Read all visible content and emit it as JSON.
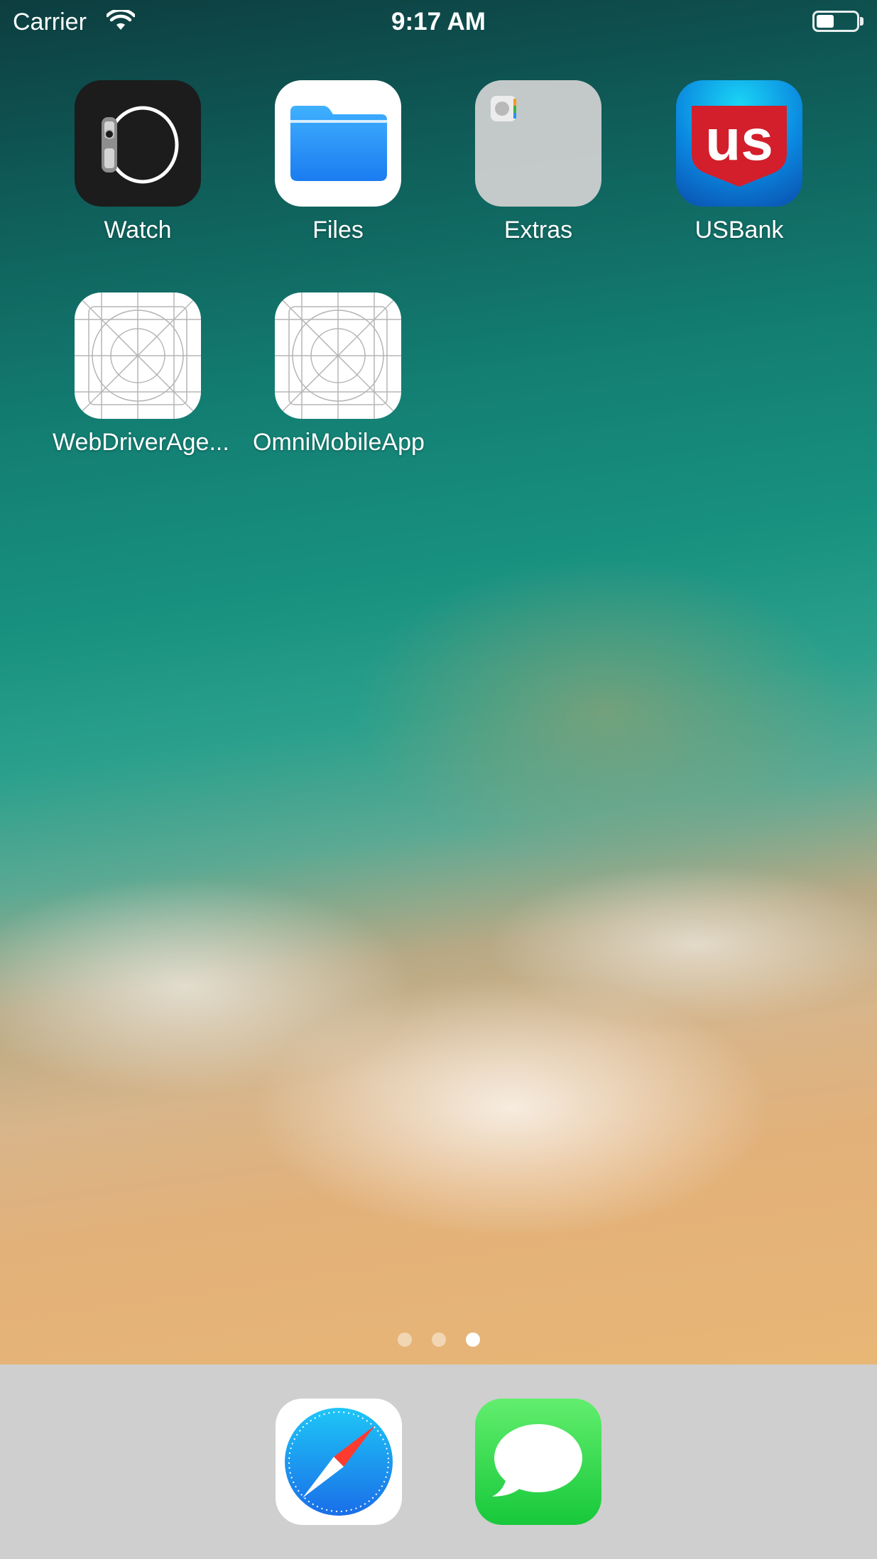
{
  "status_bar": {
    "carrier": "Carrier",
    "time": "9:17 AM",
    "battery_level": 0.45
  },
  "home_screen": {
    "apps": [
      {
        "label": "Watch"
      },
      {
        "label": "Files"
      },
      {
        "label": "Extras"
      },
      {
        "label": "USBank"
      },
      {
        "label": "WebDriverAge..."
      },
      {
        "label": "OmniMobileApp"
      }
    ],
    "usbank_logo_text": "us",
    "page_indicator": {
      "pages": 3,
      "current": 3
    }
  },
  "dock": {
    "apps": [
      {
        "name": "Safari",
        "icon": "safari-icon"
      },
      {
        "name": "Messages",
        "icon": "messages-icon"
      }
    ]
  },
  "colors": {
    "files_blue": "#1f8ef1",
    "usbank_red": "#d21f2b",
    "usbank_blue": "#0a6fd0",
    "messages_green": "#2fd14a",
    "safari_blue": "#2b8ff3",
    "dock_gray": "#cfcfcf"
  }
}
